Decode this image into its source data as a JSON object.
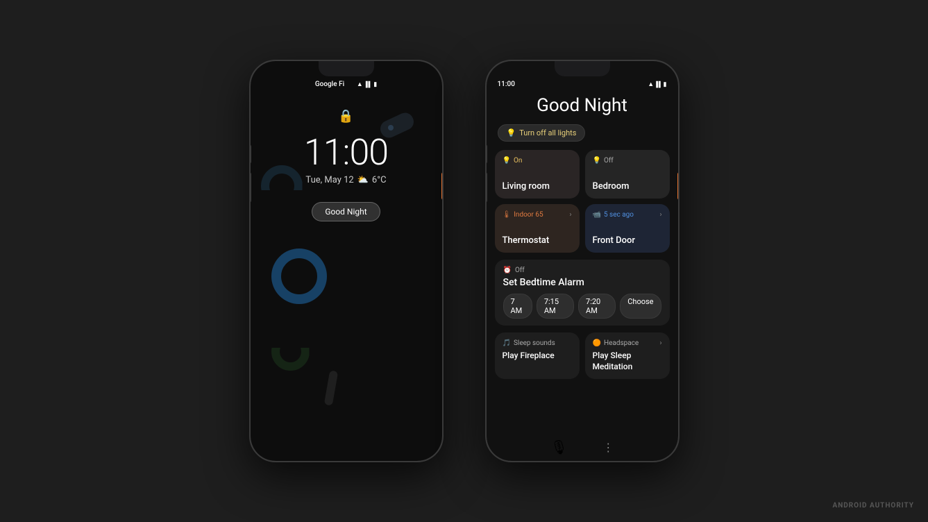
{
  "scene": {
    "background": "#1e1e1e"
  },
  "phone1": {
    "status_bar": {
      "carrier": "Google Fi",
      "time": ""
    },
    "lock_icon": "🔒",
    "time": "11:00",
    "date": "Tue, May 12",
    "weather_icon": "⛅",
    "temp": "6°C",
    "goodnight_button": "Good Night"
  },
  "phone2": {
    "status_bar": {
      "time": "11:00"
    },
    "title": "Good Night",
    "turn_off_btn": "Turn off all lights",
    "cards": [
      {
        "id": "living-room",
        "status": "On",
        "status_type": "on",
        "icon": "💡",
        "label": "Living room",
        "style": "warm"
      },
      {
        "id": "bedroom",
        "status": "Off",
        "status_type": "off",
        "icon": "💡",
        "label": "Bedroom",
        "style": "dark"
      },
      {
        "id": "thermostat",
        "status": "Indoor 65",
        "status_type": "orange",
        "icon": "🌡",
        "label": "Thermostat",
        "style": "warm",
        "has_chevron": true
      },
      {
        "id": "front-door",
        "status": "5 sec ago",
        "status_type": "blue",
        "icon": "📹",
        "label": "Front Door",
        "style": "blue",
        "has_chevron": true
      }
    ],
    "alarm": {
      "status_icon": "⏰",
      "status": "Off",
      "title": "Set Bedtime Alarm",
      "times": [
        "7 AM",
        "7:15 AM",
        "7:20 AM",
        "Choose"
      ]
    },
    "bottom_cards": [
      {
        "id": "sleep-sounds",
        "icon": "🎵",
        "category": "Sleep sounds",
        "label": "Play Fireplace"
      },
      {
        "id": "headspace",
        "icon": "🟠",
        "category": "Headspace",
        "label": "Play Sleep Meditation",
        "has_chevron": true
      }
    ],
    "navbar": {
      "mic_icon": "🎙"
    }
  },
  "watermark": "ANDROID AUTHORITY"
}
